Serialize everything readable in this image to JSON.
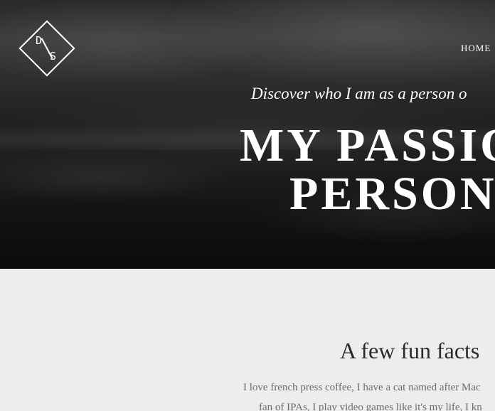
{
  "logo": {
    "letter_top": "D",
    "letter_bottom": "S"
  },
  "nav": {
    "home_label": "HOME"
  },
  "hero": {
    "tagline": "Discover who I am as a person o",
    "headline_line1": "MY PASSIO",
    "headline_line2": "PERSON"
  },
  "facts": {
    "heading": "A few fun facts",
    "line1": "I love french press coffee, I have a cat named after Mac",
    "line2": "fan of IPAs, I play video games like it's my life, I kn"
  }
}
